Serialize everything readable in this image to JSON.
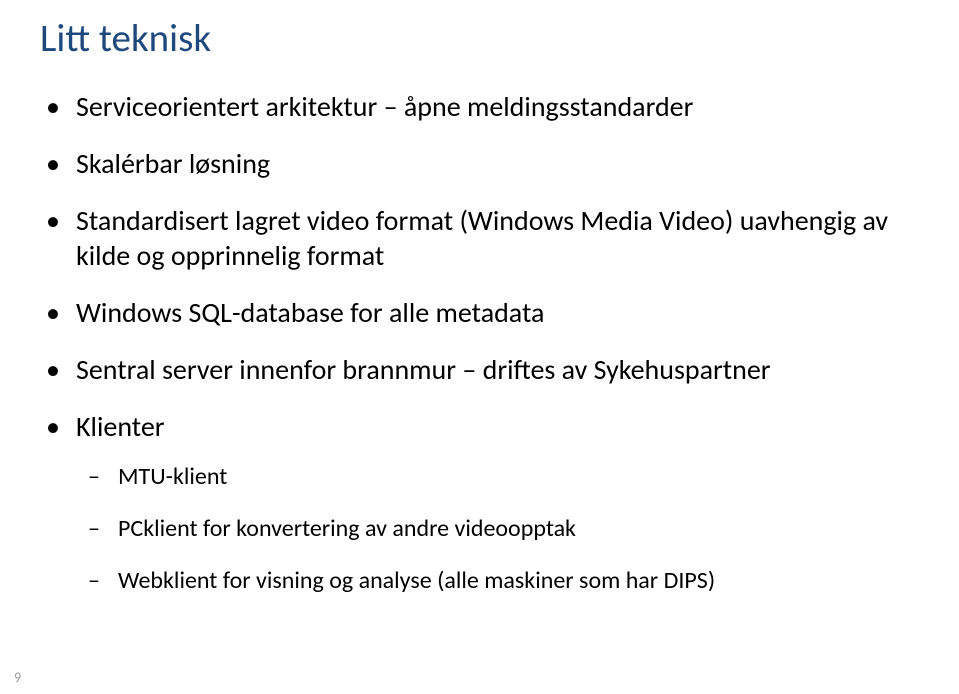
{
  "title": "Litt teknisk",
  "bullets": [
    {
      "text": "Serviceorientert arkitektur – åpne meldingsstandarder"
    },
    {
      "text": "Skalérbar løsning"
    },
    {
      "text": "Standardisert lagret video format (Windows Media Video) uavhengig av kilde og opprinnelig format"
    },
    {
      "text": "Windows SQL-database for alle metadata"
    },
    {
      "text": "Sentral server innenfor brannmur – driftes av Sykehuspartner"
    },
    {
      "text": "Klienter",
      "children": [
        {
          "text": "MTU-klient"
        },
        {
          "text": "PCklient for konvertering av andre videoopptak"
        },
        {
          "text": "Webklient for visning og analyse (alle maskiner som har DIPS)"
        }
      ]
    }
  ],
  "page_number": "9"
}
